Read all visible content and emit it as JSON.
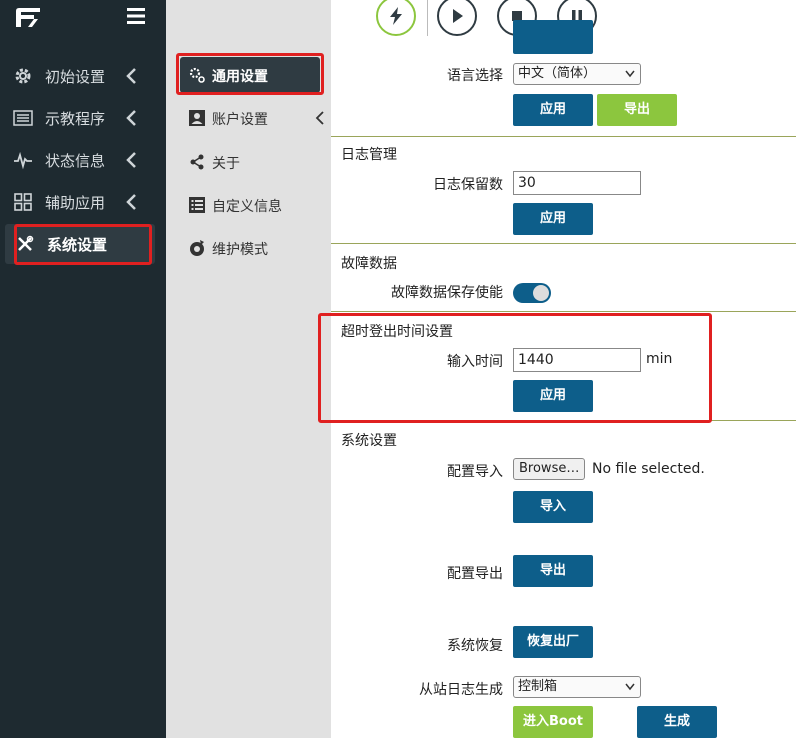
{
  "app": {
    "colors": {
      "sidebar_bg": "#1e2a30",
      "primary": "#0d5e8a",
      "accent_green": "#8cc63e",
      "highlight_red": "#e02020"
    }
  },
  "sidebar": {
    "items": [
      {
        "label": "初始设置",
        "icon": "gear-icon"
      },
      {
        "label": "示教程序",
        "icon": "list-icon"
      },
      {
        "label": "状态信息",
        "icon": "pulse-icon"
      },
      {
        "label": "辅助应用",
        "icon": "grid-icon"
      },
      {
        "label": "系统设置",
        "icon": "tools-icon",
        "active": true
      }
    ]
  },
  "subnav": {
    "items": [
      {
        "label": "通用设置",
        "icon": "gear-small-icon",
        "active": true
      },
      {
        "label": "账户设置",
        "icon": "user-icon"
      },
      {
        "label": "关于",
        "icon": "share-icon"
      },
      {
        "label": "自定义信息",
        "icon": "list-box-icon"
      },
      {
        "label": "维护模式",
        "icon": "maintenance-icon"
      }
    ]
  },
  "toolbar": {
    "icons": [
      "lightning-icon",
      "play-icon",
      "stop-icon",
      "pause-icon"
    ]
  },
  "language": {
    "label": "语言选择",
    "selected": "中文（简体）",
    "apply": "应用",
    "export": "导出"
  },
  "log": {
    "title": "日志管理",
    "retain_label": "日志保留数",
    "retain_value": "30",
    "apply": "应用"
  },
  "fault": {
    "title": "故障数据",
    "save_label": "故障数据保存使能",
    "enabled": true
  },
  "timeout": {
    "title": "超时登出时间设置",
    "input_label": "输入时间",
    "value": "1440",
    "unit": "min",
    "apply": "应用"
  },
  "system": {
    "title": "系统设置",
    "import_label": "配置导入",
    "browse": "Browse…",
    "no_file": "No file selected.",
    "import_btn": "导入",
    "export_label": "配置导出",
    "export_btn": "导出",
    "restore_label": "系统恢复",
    "restore_btn": "恢复出厂",
    "slave_log_label": "从站日志生成",
    "slave_log_selected": "控制箱",
    "boot_btn": "进入Boot",
    "generate_btn": "生成"
  }
}
